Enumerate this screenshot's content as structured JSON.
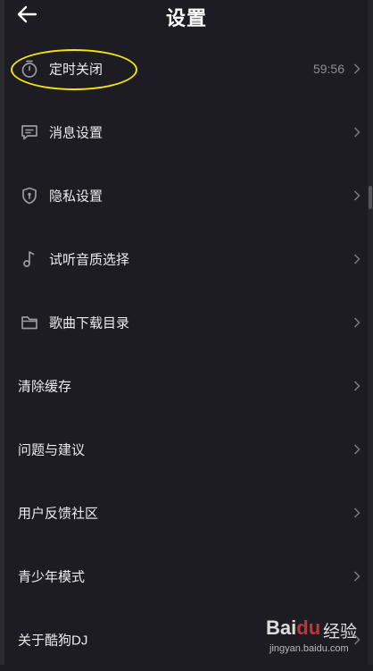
{
  "header": {
    "title": "设置",
    "back_icon": "arrow-left-icon"
  },
  "settings": [
    {
      "label": "定时关闭",
      "icon": "timer-icon",
      "value": "59:56"
    },
    {
      "label": "消息设置",
      "icon": "message-icon"
    },
    {
      "label": "隐私设置",
      "icon": "shield-icon"
    },
    {
      "label": "试听音质选择",
      "icon": "music-note-icon"
    },
    {
      "label": "歌曲下载目录",
      "icon": "folder-icon"
    },
    {
      "label": "清除缓存"
    },
    {
      "label": "问题与建议"
    },
    {
      "label": "用户反馈社区"
    },
    {
      "label": "青少年模式"
    },
    {
      "label": "关于酷狗DJ"
    }
  ],
  "watermark": {
    "brand": "Bai",
    "paw": "du",
    "cn": "经验",
    "url": "jingyan.baidu.com"
  },
  "colors": {
    "background": "#1c1c22",
    "highlight": "#f5e40a",
    "icon": "#9a9aa3"
  }
}
